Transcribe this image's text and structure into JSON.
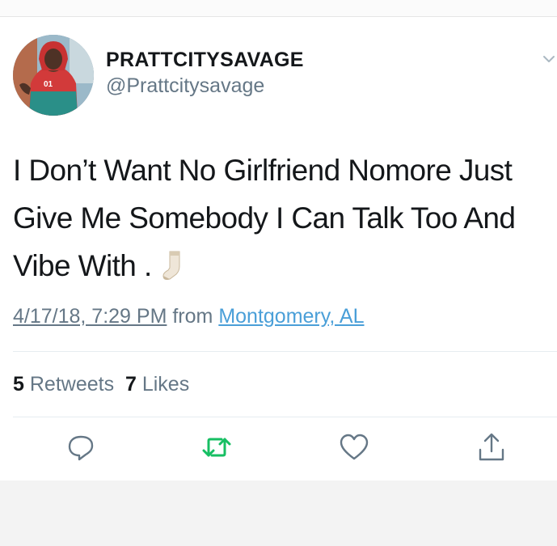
{
  "tweet": {
    "display_name": "PRATTCITYSAVAGE",
    "handle": "@Prattcitysavage",
    "text_line1": "I Don’t Want No Girlfriend Nomore Just",
    "text_line2": "Give Me Somebody I Can Talk Too And",
    "text_line3": "Vibe With .",
    "emoji": "sock",
    "timestamp": "4/17/18, 7:29 PM",
    "from_label": "from",
    "location": "Montgomery, AL",
    "retweets_count": "5",
    "retweets_label": "Retweets",
    "likes_count": "7",
    "likes_label": "Likes"
  },
  "actions": [
    {
      "name": "reply",
      "icon": "reply-icon"
    },
    {
      "name": "retweet",
      "icon": "retweet-icon",
      "color": "#17bf63"
    },
    {
      "name": "like",
      "icon": "heart-icon"
    },
    {
      "name": "share",
      "icon": "share-icon"
    }
  ],
  "colors": {
    "text": "#14171a",
    "secondary": "#657786",
    "link": "#4a9fd8",
    "retweet_green": "#17bf63"
  }
}
